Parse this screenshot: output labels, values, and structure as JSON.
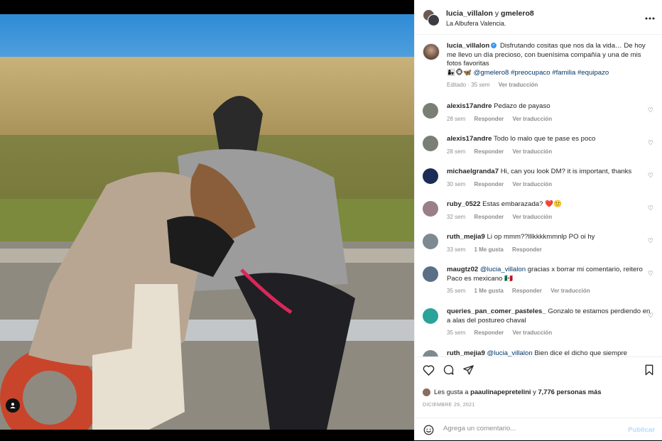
{
  "header": {
    "user1": "lucia_villalon",
    "joiner": "y",
    "user2": "gmelero8",
    "location": "La Albufera Valencia.",
    "more_icon": "more-horizontal-icon"
  },
  "caption": {
    "username": "lucia_villalon",
    "text": "Disfrutando cositas que nos da la vida… De hoy me llevo un día precioso, con buenísima compañía y una de mis fotos favoritas",
    "emojis": "👩‍👧🐵🦋",
    "tags": [
      "@gmelero8",
      "#preocupaco",
      "#familia",
      "#equipazo"
    ],
    "edited": "Editado · 35 sem",
    "translate": "Ver traducción"
  },
  "comments": [
    {
      "username": "alexis17andre",
      "text": "Pedazo de payaso",
      "time": "28 sem",
      "actions": [
        "Responder",
        "Ver traducción"
      ],
      "avatar_color": "#7a7f73"
    },
    {
      "username": "alexis17andre",
      "text": "Todo lo malo que te pase es poco",
      "time": "28 sem",
      "actions": [
        "Responder",
        "Ver traducción"
      ],
      "avatar_color": "#7a7f73"
    },
    {
      "username": "michaelgranda7",
      "text": "Hi, can you look DM? it is important, thanks",
      "time": "30 sem",
      "actions": [
        "Responder",
        "Ver traducción"
      ],
      "avatar_color": "#1b2c57"
    },
    {
      "username": "ruby_0522",
      "text": "Estas embarazada? ❤️🙂",
      "time": "32 sem",
      "actions": [
        "Responder",
        "Ver traducción"
      ],
      "avatar_color": "#9b7f86"
    },
    {
      "username": "ruth_mejia9",
      "text": "Li op mmm??lllkkkkmmnlp PO oi hy",
      "time": "33 sem",
      "likes": "1 Me gusta",
      "actions": [
        "Responder"
      ],
      "avatar_color": "#7d8a91"
    },
    {
      "username": "maugtz02",
      "mention": "@lucia_villalon",
      "text": "gracias x borrar mi comentario, reitero Paco es mexicano 🇲🇽",
      "time": "35 sem",
      "likes": "1 Me gusta",
      "actions": [
        "Responder",
        "Ver traducción"
      ],
      "avatar_color": "#5b6f86"
    },
    {
      "username": "queries_pan_comer_pasteles_",
      "text": "Gonzalo te estamos perdiendo en a alas del postureo chaval",
      "time": "35 sem",
      "actions": [
        "Responder",
        "Ver traducción"
      ],
      "avatar_color": "#2aa39a"
    },
    {
      "username": "ruth_mejia9",
      "mention": "@lucia_villalon",
      "text": "Bien dice el dicho que siempre",
      "time": "",
      "actions": [],
      "avatar_color": "#7d8a91"
    }
  ],
  "actions": {
    "like_icon": "heart-icon",
    "comment_icon": "comment-icon",
    "share_icon": "send-icon",
    "save_icon": "bookmark-icon"
  },
  "likes": {
    "prefix": "Les gusta a",
    "user": "paaulinapepretelini",
    "joiner": "y",
    "others": "7,776 personas más"
  },
  "date": "DICIEMBRE 29, 2021",
  "add_comment": {
    "placeholder": "Agrega un comentario...",
    "publish": "Publicar"
  },
  "colors": {
    "link": "#00376b",
    "muted": "#8e8e8e",
    "publish_disabled": "#b3dbff",
    "verified": "#3897f0"
  }
}
